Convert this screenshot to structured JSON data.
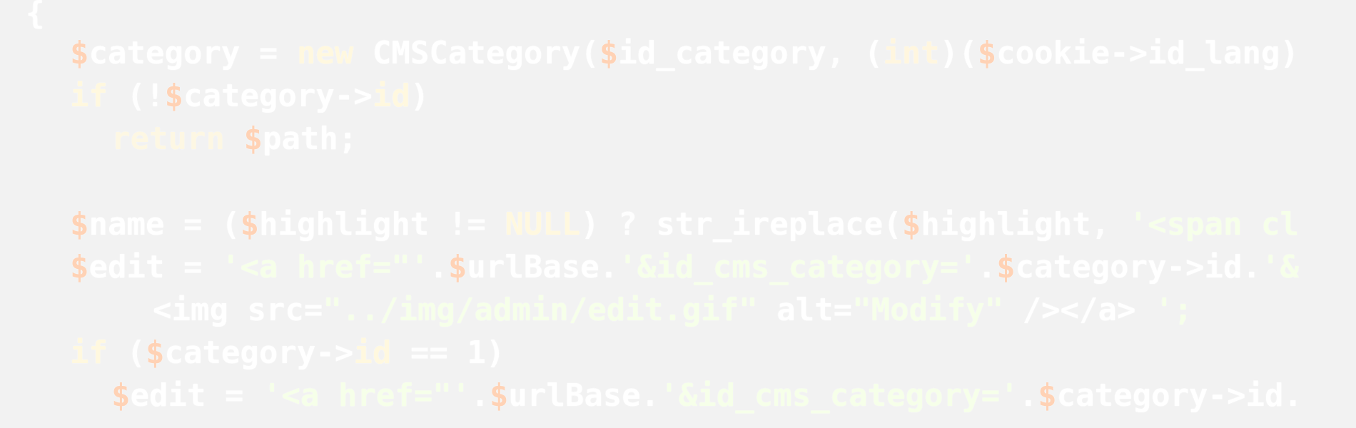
{
  "editor": {
    "lines": [
      [
        "{"
      ],
      [
        "$",
        "category",
        " = ",
        "new",
        " ",
        "CMSCategory",
        "(",
        "$",
        "id_category",
        ", ",
        "(",
        "int",
        ")",
        "(",
        "$",
        "cookie",
        "->",
        "id_lang",
        ")"
      ],
      [
        "if",
        " (",
        "!",
        "$",
        "category",
        "->",
        "id",
        ")"
      ],
      [
        "return",
        " ",
        "$",
        "path",
        ";"
      ],
      [
        "$",
        "name",
        " = ",
        "(",
        "$",
        "highlight",
        " != ",
        "NULL",
        ")",
        " ? ",
        "str_ireplace",
        "(",
        "$",
        "highlight",
        ", ",
        "'<span cl"
      ],
      [
        "$",
        "edit",
        " = ",
        "'<a href=\"'",
        ".",
        "$",
        "urlBase",
        ".",
        "'&id_cms_category='",
        ".",
        "$",
        "category",
        "->",
        "id",
        ".",
        "'&"
      ],
      [
        "<img src=",
        "\"../img/admin/edit.gif\"",
        " alt=",
        "\"Modify\"",
        " /></a> ",
        "';"
      ],
      [
        "if",
        " (",
        "$",
        "category",
        "->",
        "id",
        " == ",
        "1",
        ")"
      ],
      [
        "$",
        "edit",
        " = ",
        "'<a href=\"'",
        ".",
        "$",
        "urlBase",
        ".",
        "'&id_cms_category='",
        ".",
        "$",
        "category",
        "->",
        "id",
        "."
      ]
    ]
  }
}
